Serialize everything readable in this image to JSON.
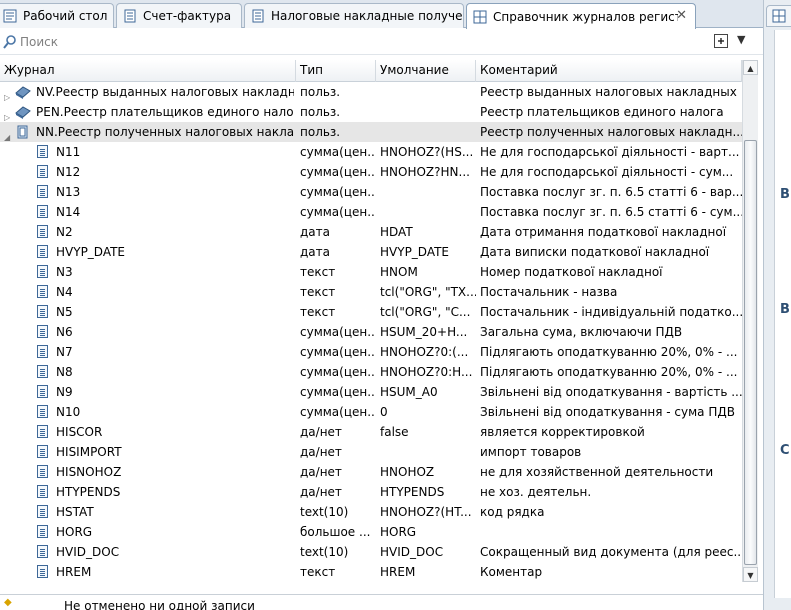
{
  "tabs": [
    {
      "label": "Рабочий стол",
      "active": false
    },
    {
      "label": "Счет-фактура",
      "active": false
    },
    {
      "label": "Налоговые накладные получен",
      "active": false
    },
    {
      "label": "Справочник журналов регистр",
      "active": true
    }
  ],
  "tab_close": "✕",
  "search": {
    "placeholder": "Поиск"
  },
  "toolbar_menu": "▼",
  "side_panel": {
    "letters": [
      "В",
      "В",
      "С"
    ]
  },
  "columns": [
    "Журнал",
    "Тип",
    "Умолчание",
    "Коментарий"
  ],
  "rows": [
    {
      "kind": "journal",
      "expanded": false,
      "name": "NV.Реестр выданных налоговых накладных",
      "type": "польз.",
      "default": "",
      "comment": "Реестр выданных налоговых накладных"
    },
    {
      "kind": "journal",
      "expanded": false,
      "name": "PEN.Реестр плательщиков единого налога",
      "type": "польз.",
      "default": "",
      "comment": "Реестр плательщиков единого налога"
    },
    {
      "kind": "journal",
      "expanded": true,
      "selected": true,
      "name": "NN.Реестр полученных налоговых накладных",
      "type": "польз.",
      "default": "",
      "comment": "Реестр полученных налоговых накладн..."
    },
    {
      "kind": "field",
      "name": "N11",
      "type": "сумма(цен...",
      "default": "HNOHOZ?(HS...",
      "comment": "Не для господарської діяльності - варт..."
    },
    {
      "kind": "field",
      "name": "N12",
      "type": "сумма(цен...",
      "default": "HNOHOZ?HN...",
      "comment": "Не для господарської діяльності - сум..."
    },
    {
      "kind": "field",
      "name": "N13",
      "type": "сумма(цен...",
      "default": "",
      "comment": "Поставка послуг зг. п. 6.5 статті 6 - вар..."
    },
    {
      "kind": "field",
      "name": "N14",
      "type": "сумма(цен...",
      "default": "",
      "comment": "Поставка послуг зг. п. 6.5 статті 6 - сум..."
    },
    {
      "kind": "field",
      "name": "N2",
      "type": "дата",
      "default": "HDAT",
      "comment": "Дата отримання податкової накладної"
    },
    {
      "kind": "field",
      "name": "HVYP_DATE",
      "type": "дата",
      "default": "HVYP_DATE",
      "comment": "Дата виписки податкової накладної"
    },
    {
      "kind": "field",
      "name": "N3",
      "type": "текст",
      "default": "HNOM",
      "comment": "Номер податкової накладної"
    },
    {
      "kind": "field",
      "name": "N4",
      "type": "текст",
      "default": "tcl(\"ORG\", \"TX...",
      "comment": "Постачальник - назва"
    },
    {
      "kind": "field",
      "name": "N5",
      "type": "текст",
      "default": "tcl(\"ORG\", \"C...",
      "comment": "Постачальник - індивідуальній податко..."
    },
    {
      "kind": "field",
      "name": "N6",
      "type": "сумма(цен...",
      "default": "HSUM_20+H...",
      "comment": "Загальна сума, включаючи ПДВ"
    },
    {
      "kind": "field",
      "name": "N7",
      "type": "сумма(цен...",
      "default": "HNOHOZ?0:(...",
      "comment": "Підлягають оподаткуванню 20%, 0% - ..."
    },
    {
      "kind": "field",
      "name": "N8",
      "type": "сумма(цен...",
      "default": "HNOHOZ?0:H...",
      "comment": "Підлягають оподаткуванню 20%, 0% - ..."
    },
    {
      "kind": "field",
      "name": "N9",
      "type": "сумма(цен...",
      "default": "HSUM_A0",
      "comment": "Звільнені від оподаткування - вартість ..."
    },
    {
      "kind": "field",
      "name": "N10",
      "type": "сумма(цен...",
      "default": "0",
      "comment": "Звільнені від оподаткування - сума ПДВ"
    },
    {
      "kind": "field",
      "name": "HISCOR",
      "type": "да/нет",
      "default": "false",
      "comment": "является корректировкой"
    },
    {
      "kind": "field",
      "name": "HISIMPORT",
      "type": "да/нет",
      "default": "",
      "comment": "импорт товаров"
    },
    {
      "kind": "field",
      "name": "HISNOHOZ",
      "type": "да/нет",
      "default": "HNOHOZ",
      "comment": "не для хозяйственной деятельности"
    },
    {
      "kind": "field",
      "name": "HTYPENDS",
      "type": "да/нет",
      "default": "HTYPENDS",
      "comment": "не хоз. деятельн."
    },
    {
      "kind": "field",
      "name": "HSTAT",
      "type": "text(10)",
      "default": "HNOHOZ?(HT...",
      "comment": "код рядка"
    },
    {
      "kind": "field",
      "name": "HORG",
      "type": "большое ...",
      "default": "HORG",
      "comment": ""
    },
    {
      "kind": "field",
      "name": "HVID_DOC",
      "type": "text(10)",
      "default": "HVID_DOC",
      "comment": "Сокращенный вид документа (для реес..."
    },
    {
      "kind": "field",
      "name": "HREM",
      "type": "текст",
      "default": "HREM",
      "comment": "Коментар"
    }
  ],
  "status": {
    "text": "Не отменено ни одной записи"
  },
  "colors": {
    "tab_bar": "#dfe6ee",
    "selected_row": "#e6e6e6",
    "icon_blue": "#3d6797"
  }
}
